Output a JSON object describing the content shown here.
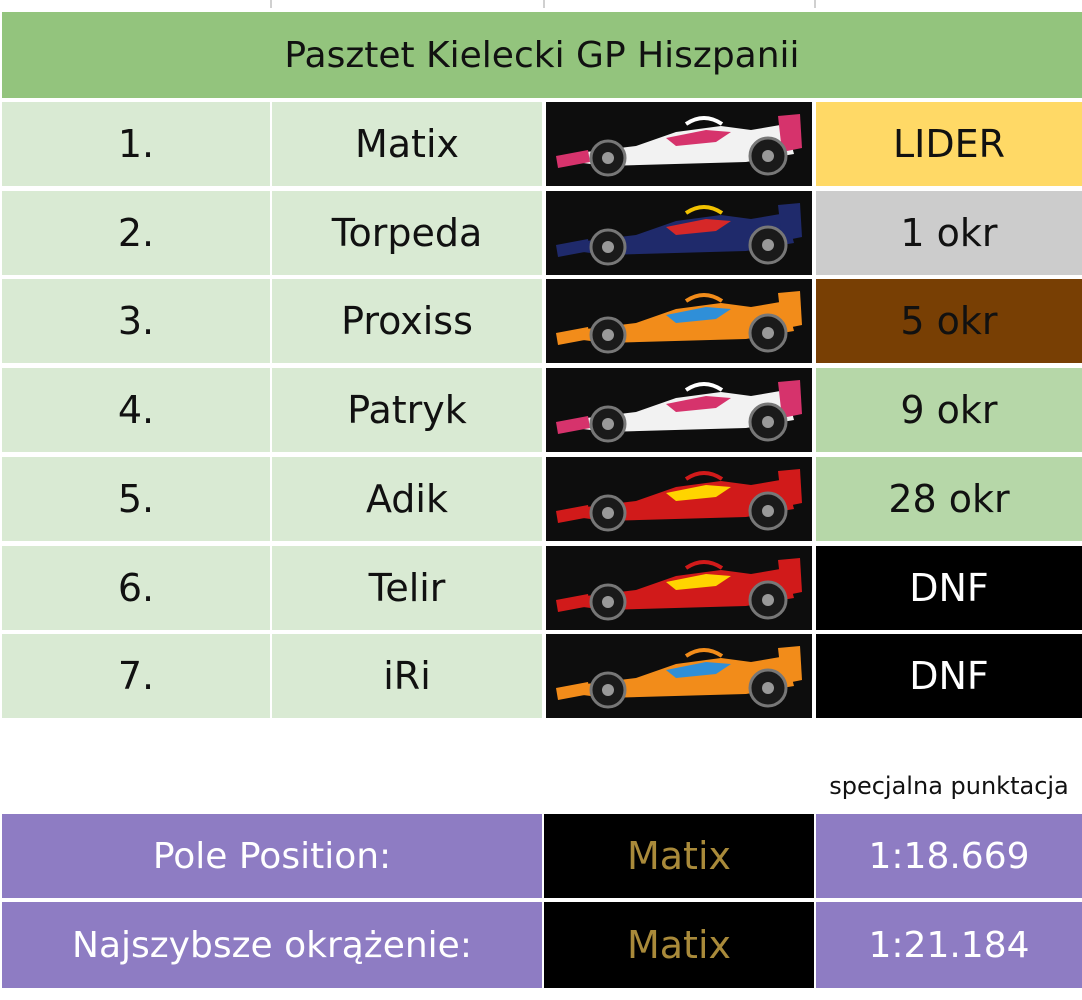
{
  "title": "Pasztet Kielecki GP Hiszpanii",
  "colors": {
    "header_bg": "#93c47d",
    "row_bg": "#d9ead3",
    "leader": "#ffd966",
    "second": "#cccccc",
    "third": "#783f04",
    "points": "#b6d7a8",
    "dnf": "#000000",
    "summary": "#8e7cc3",
    "gold_text": "#a98a3a"
  },
  "rows": [
    {
      "pos": "1.",
      "name": "Matix",
      "car": "haas",
      "result": "LIDER",
      "result_style": "leader"
    },
    {
      "pos": "2.",
      "name": "Torpeda",
      "car": "redbull",
      "result": "1 okr",
      "result_style": "second"
    },
    {
      "pos": "3.",
      "name": "Proxiss",
      "car": "mclaren",
      "result": "5 okr",
      "result_style": "third"
    },
    {
      "pos": "4.",
      "name": "Patryk",
      "car": "haas",
      "result": "9 okr",
      "result_style": "points"
    },
    {
      "pos": "5.",
      "name": "Adik",
      "car": "ferrari",
      "result": "28 okr",
      "result_style": "points"
    },
    {
      "pos": "6.",
      "name": "Telir",
      "car": "ferrari",
      "result": "DNF",
      "result_style": "dnf"
    },
    {
      "pos": "7.",
      "name": "iRi",
      "car": "mclaren",
      "result": "DNF",
      "result_style": "dnf"
    }
  ],
  "note": "specjalna punktacja",
  "pole": {
    "label": "Pole Position:",
    "driver": "Matix",
    "time": "1:18.669"
  },
  "fastest": {
    "label": "Najszybsze okrążenie:",
    "driver": "Matix",
    "time": "1:21.184"
  }
}
